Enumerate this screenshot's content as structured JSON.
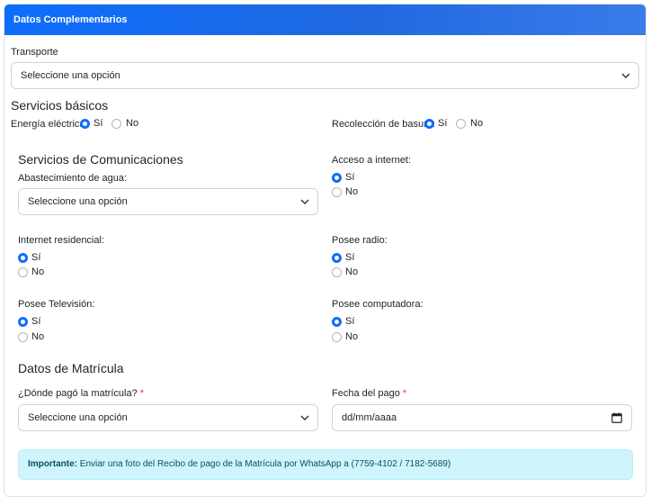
{
  "header": {
    "title": "Datos Complementarios"
  },
  "transporte": {
    "label": "Transporte",
    "value": "Seleccione una opción"
  },
  "servicios_basicos": {
    "title": "Servicios básicos",
    "energia": {
      "label": "Energía eléctrica:",
      "selected": "Sí"
    },
    "basura": {
      "label": "Recolección de basura:",
      "selected": "Sí"
    }
  },
  "radio_options": {
    "yes": "Sí",
    "no": "No"
  },
  "comunicaciones": {
    "title": "Servicios de Comunicaciones",
    "agua": {
      "label": "Abastecimiento de agua:",
      "value": "Seleccione una opción"
    },
    "internet": {
      "label": "Acceso a internet:",
      "selected": "Sí"
    },
    "internet_residencial": {
      "label": "Internet residencial:",
      "selected": "Sí"
    },
    "radio": {
      "label": "Posee radio:",
      "selected": "Sí"
    },
    "television": {
      "label": "Posee Televisión:",
      "selected": "Sí"
    },
    "computadora": {
      "label": "Posee computadora:",
      "selected": "Sí"
    }
  },
  "matricula": {
    "title": "Datos de Matrícula",
    "lugar": {
      "label": "¿Dónde pagó la matrícula?",
      "required": "*",
      "value": "Seleccione una opción"
    },
    "fecha": {
      "label": "Fecha del pago",
      "required": "*",
      "value": "dd/mm/aaaa"
    }
  },
  "alert": {
    "strong": "Importante:",
    "text": "Enviar una foto del Recibo de pago de la Matrícula por WhatsApp a (7759-4102 / 7182-5689)"
  },
  "colors": {
    "primary": "#0d6efd",
    "alert_bg": "#cff4fc",
    "alert_text": "#055160",
    "required": "#dc3545"
  }
}
